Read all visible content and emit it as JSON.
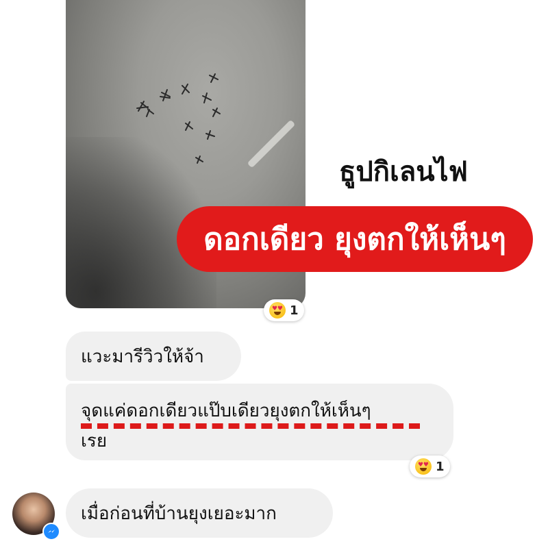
{
  "photo": {
    "description_icon": "photo-attachment"
  },
  "overlay": {
    "caption": "ธูปกิเลนไฟ",
    "banner": "ดอกเดียว ยุงตกให้เห็นๆ"
  },
  "reactions": [
    {
      "icon": "heart-eyes-emoji",
      "count": "1"
    },
    {
      "icon": "heart-eyes-emoji",
      "count": "1"
    }
  ],
  "messages": [
    {
      "text": "แวะมารีวิวให้จ้า"
    },
    {
      "line1": "จุดแค่ดอกเดียวแป๊บเดียวยุงตกให้เห็นๆ",
      "line2": "เรย"
    },
    {
      "text": "เมื่อก่อนที่บ้านยุงเยอะมาก"
    }
  ],
  "colors": {
    "banner": "#e11b1b",
    "bubble": "#f0f0f0",
    "underline": "#dd1a1a",
    "messenger": "#1f8bff"
  }
}
